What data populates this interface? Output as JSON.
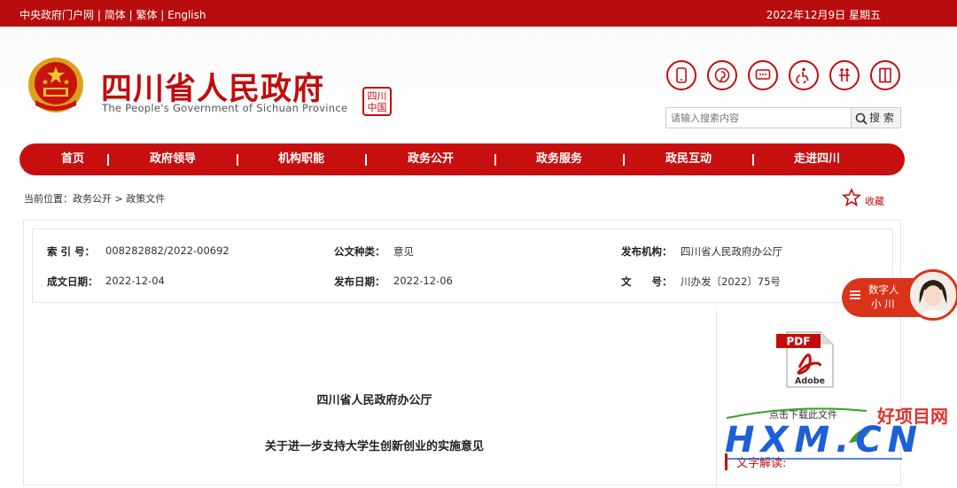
{
  "topbar": {
    "links": [
      "中央政府门户网",
      "简体",
      "繁体",
      "English"
    ],
    "separator": "|",
    "date": "2022年12月9日 星期五"
  },
  "header": {
    "title": "四川省人民政府",
    "subtitle": "The People's Government of Sichuan Province",
    "seal_text": "四川中国"
  },
  "icons": [
    "mobile-icon",
    "pinterest-icon",
    "message-icon",
    "accessibility-icon",
    "elderly-care-icon",
    "exit-icon"
  ],
  "search": {
    "placeholder": "请输入搜索内容",
    "button_label": "搜 索"
  },
  "nav": {
    "items": [
      "首页",
      "政府领导",
      "机构职能",
      "政务公开",
      "政务服务",
      "政民互动",
      "走进四川"
    ]
  },
  "breadcrumb": {
    "text": "当前位置：政务公开 > 政策文件"
  },
  "favorite": {
    "label": "收藏"
  },
  "meta": {
    "index_label": "索 引 号：",
    "index_value": "008282882/2022-00692",
    "type_label": "公文种类：",
    "type_value": "意见",
    "issuer_label": "发布机构：",
    "issuer_value": "四川省人民政府办公厅",
    "written_label": "成文日期：",
    "written_value": "2022-12-04",
    "published_label": "发布日期：",
    "published_value": "2022-12-06",
    "docno_label": "文　　号：",
    "docno_value": "川办发〔2022〕75号"
  },
  "article": {
    "org": "四川省人民政府办公厅",
    "title": "关于进一步支持大学生创新创业的实施意见"
  },
  "sidebar": {
    "pdf_badge": "PDF",
    "pdf_brand": "Adobe",
    "download_label": "点击下载此文件",
    "interpretation_label": "文字解读:"
  },
  "assistant": {
    "line1": "数字人",
    "line2": "小 川"
  },
  "watermark": {
    "cn": "好项目网",
    "en": "HXM.CN"
  },
  "colors": {
    "brand_red": "#c20d0d",
    "topbar_red": "#b80d0d",
    "watermark_blue": "#1d5fd6"
  }
}
